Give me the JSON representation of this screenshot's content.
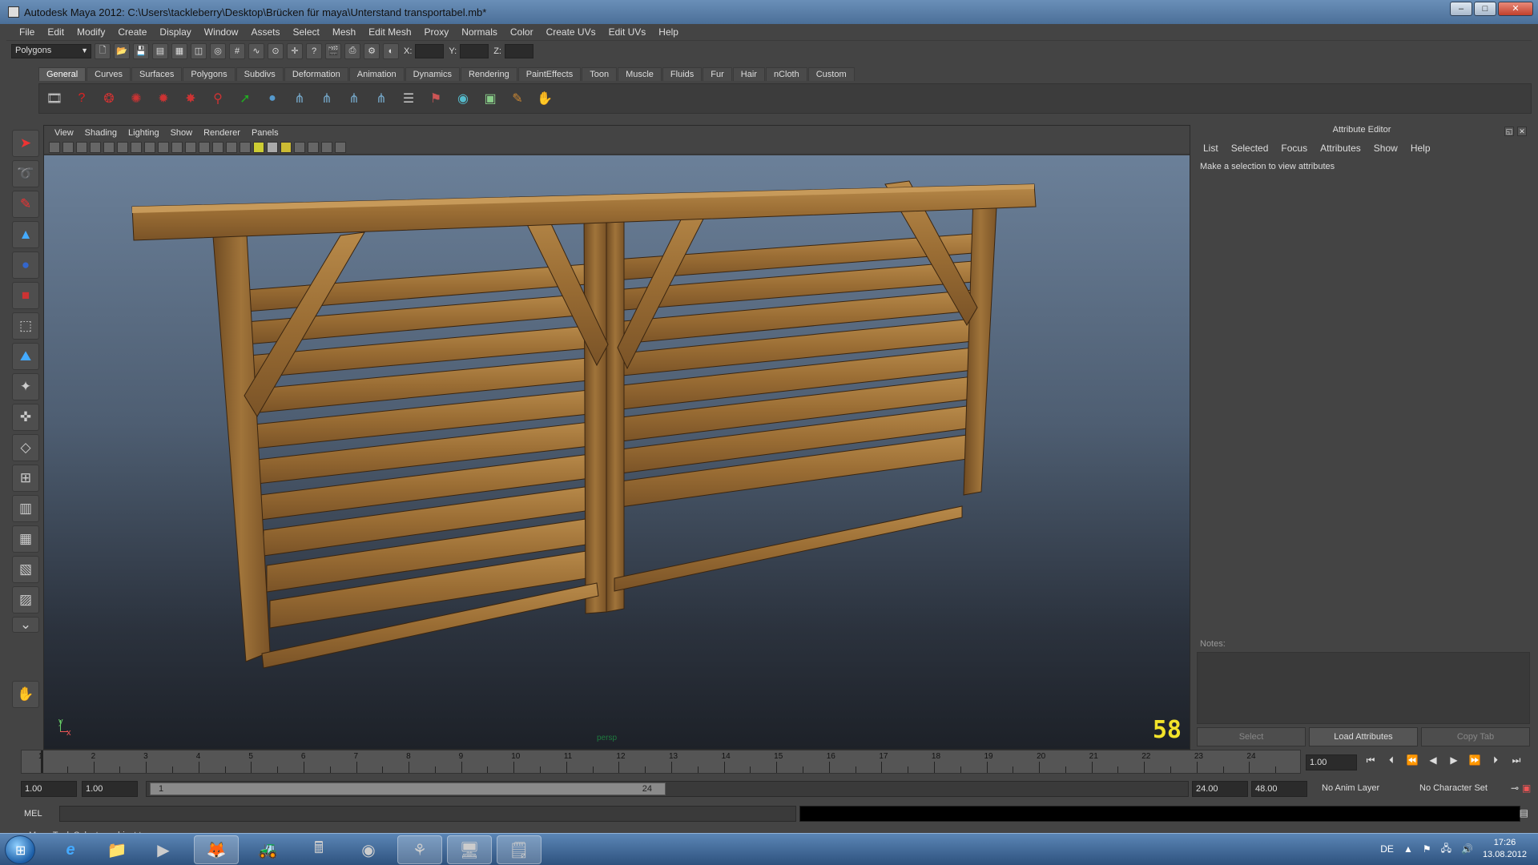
{
  "window": {
    "title": "Autodesk Maya 2012: C:\\Users\\tackleberry\\Desktop\\Brücken für maya\\Unterstand transportabel.mb*",
    "buttons": [
      "–",
      "□",
      "✕"
    ]
  },
  "menubar": [
    "File",
    "Edit",
    "Modify",
    "Create",
    "Display",
    "Window",
    "Assets",
    "Select",
    "Mesh",
    "Edit Mesh",
    "Proxy",
    "Normals",
    "Color",
    "Create UVs",
    "Edit UVs",
    "Help"
  ],
  "statusline": {
    "mode": "Polygons",
    "x_label": "X:",
    "y_label": "Y:",
    "z_label": "Z:"
  },
  "shelf": {
    "tabs": [
      "General",
      "Curves",
      "Surfaces",
      "Polygons",
      "Subdivs",
      "Deformation",
      "Animation",
      "Dynamics",
      "Rendering",
      "PaintEffects",
      "Toon",
      "Muscle",
      "Fluids",
      "Fur",
      "Hair",
      "nCloth",
      "Custom"
    ],
    "active_tab": "General"
  },
  "viewport": {
    "menu": [
      "View",
      "Shading",
      "Lighting",
      "Show",
      "Renderer",
      "Panels"
    ],
    "camera": "persp",
    "fps": "58",
    "axis_y": "y",
    "axis_x": "x"
  },
  "attribute_editor": {
    "title": "Attribute Editor",
    "menu": [
      "List",
      "Selected",
      "Focus",
      "Attributes",
      "Show",
      "Help"
    ],
    "hint": "Make a selection to view attributes",
    "notes_label": "Notes:",
    "buttons": {
      "select": "Select",
      "load": "Load Attributes",
      "copy": "Copy Tab"
    }
  },
  "timeslider": {
    "frames": [
      "1",
      "2",
      "3",
      "4",
      "5",
      "6",
      "7",
      "8",
      "9",
      "10",
      "11",
      "12",
      "13",
      "14",
      "15",
      "16",
      "17",
      "18",
      "19",
      "20",
      "21",
      "22",
      "23",
      "24"
    ],
    "current_frame": "1.00"
  },
  "range": {
    "start": "1.00",
    "playback_start": "1.00",
    "slider_start": "1",
    "slider_end": "24",
    "playback_end": "24.00",
    "end": "48.00",
    "anim_layer": "No Anim Layer",
    "character_set": "No Character Set"
  },
  "commandline": {
    "label": "MEL",
    "help": "Move Tool: Select an object to move."
  },
  "taskbar": {
    "language": "DE",
    "time": "17:26",
    "date": "13.08.2012"
  }
}
